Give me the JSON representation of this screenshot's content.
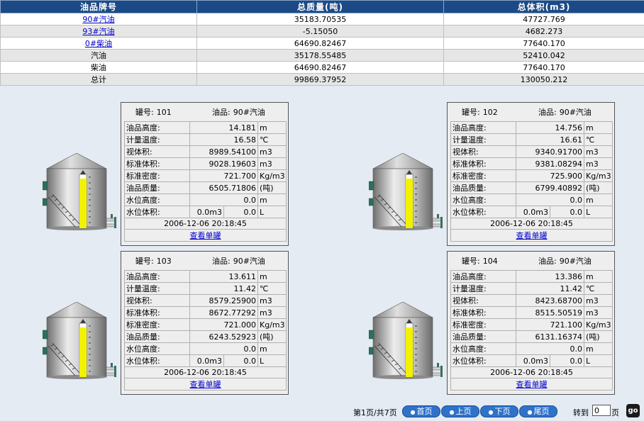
{
  "summary": {
    "headers": [
      "油品牌号",
      "总质量(吨)",
      "总体积(m3)"
    ],
    "rows": [
      {
        "name": "90#汽油",
        "mass": "35183.70535",
        "volume": "47727.769",
        "link": true
      },
      {
        "name": "93#汽油",
        "mass": "-5.15050",
        "volume": "4682.273",
        "link": true
      },
      {
        "name": "0#柴油",
        "mass": "64690.82467",
        "volume": "77640.170",
        "link": true
      },
      {
        "name": "汽油",
        "mass": "35178.55485",
        "volume": "52410.042",
        "link": false
      },
      {
        "name": "柴油",
        "mass": "64690.82467",
        "volume": "77640.170",
        "link": false
      },
      {
        "name": "总计",
        "mass": "99869.37952",
        "volume": "130050.212",
        "link": false
      }
    ]
  },
  "labels": {
    "tank_no": "罐号:",
    "oil": "油品:",
    "height": "油品高度:",
    "temp": "计量温度:",
    "view_vol": "视体积:",
    "std_vol": "标准体积:",
    "std_density": "标准密度:",
    "mass": "油品质量:",
    "water_height": "水位高度:",
    "water_vol": "水位体积:",
    "view_detail": "查看单罐"
  },
  "tanks": [
    {
      "no": "101",
      "oil": "90#汽油",
      "height": "14.181",
      "height_unit": "m",
      "temp": "16.58",
      "temp_unit": "℃",
      "view_vol": "8989.54100",
      "view_vol_unit": "m3",
      "std_vol": "9028.19603",
      "std_vol_unit": "m3",
      "density": "721.700",
      "density_unit": "Kg/m3",
      "mass": "6505.71806",
      "mass_unit": "(吨)",
      "water_height": "0.0",
      "water_height_unit": "m",
      "water_vol_a": "0.0m3",
      "water_vol_b": "0.0",
      "water_vol_b_unit": "L",
      "time": "2006-12-06 20:18:45"
    },
    {
      "no": "102",
      "oil": "90#汽油",
      "height": "14.756",
      "height_unit": "m",
      "temp": "16.61",
      "temp_unit": "℃",
      "view_vol": "9340.91700",
      "view_vol_unit": "m3",
      "std_vol": "9381.08294",
      "std_vol_unit": "m3",
      "density": "725.900",
      "density_unit": "Kg/m3",
      "mass": "6799.40892",
      "mass_unit": "(吨)",
      "water_height": "0.0",
      "water_height_unit": "m",
      "water_vol_a": "0.0m3",
      "water_vol_b": "0.0",
      "water_vol_b_unit": "L",
      "time": "2006-12-06 20:18:45"
    },
    {
      "no": "103",
      "oil": "90#汽油",
      "height": "13.611",
      "height_unit": "m",
      "temp": "11.42",
      "temp_unit": "℃",
      "view_vol": "8579.25900",
      "view_vol_unit": "m3",
      "std_vol": "8672.77292",
      "std_vol_unit": "m3",
      "density": "721.000",
      "density_unit": "Kg/m3",
      "mass": "6243.52923",
      "mass_unit": "(吨)",
      "water_height": "0.0",
      "water_height_unit": "m",
      "water_vol_a": "0.0m3",
      "water_vol_b": "0.0",
      "water_vol_b_unit": "L",
      "time": "2006-12-06 20:18:45"
    },
    {
      "no": "104",
      "oil": "90#汽油",
      "height": "13.386",
      "height_unit": "m",
      "temp": "11.42",
      "temp_unit": "℃",
      "view_vol": "8423.68700",
      "view_vol_unit": "m3",
      "std_vol": "8515.50519",
      "std_vol_unit": "m3",
      "density": "721.100",
      "density_unit": "Kg/m3",
      "mass": "6131.16374",
      "mass_unit": "(吨)",
      "water_height": "0.0",
      "water_height_unit": "m",
      "water_vol_a": "0.0m3",
      "water_vol_b": "0.0",
      "water_vol_b_unit": "L",
      "time": "2006-12-06 20:18:45"
    }
  ],
  "pager": {
    "info": "第1页/共7页",
    "first": "首页",
    "prev": "上页",
    "next": "下页",
    "last": "尾页",
    "goto": "转到",
    "page_value": "0",
    "page_suffix": "页",
    "go": "go"
  },
  "colors": {
    "header_bg": "#1c4a86",
    "oil_level": "#f2f200",
    "button_bg": "#2f72c9"
  }
}
